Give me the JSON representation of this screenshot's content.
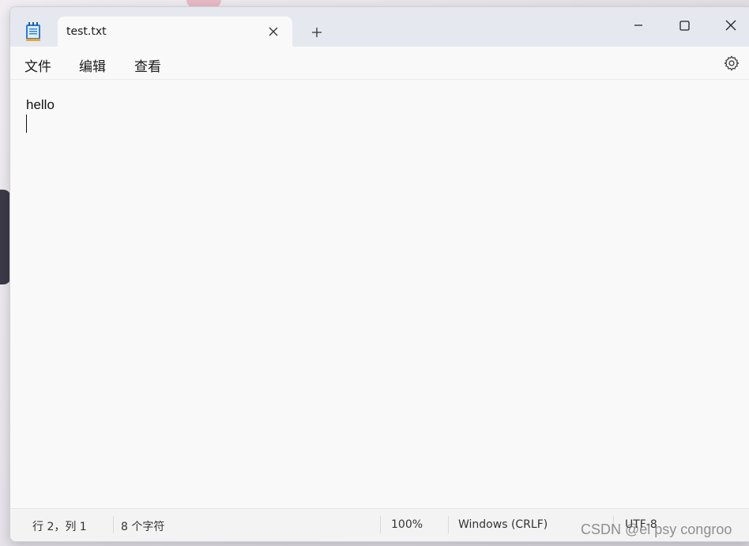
{
  "tab": {
    "title": "test.txt"
  },
  "menu": {
    "file": "文件",
    "edit": "编辑",
    "view": "查看"
  },
  "editor": {
    "lines": [
      "hello",
      ""
    ]
  },
  "status": {
    "position": "行 2，列 1",
    "chars": "8 个字符",
    "zoom": "100%",
    "line_ending": "Windows (CRLF)",
    "encoding": "UTF-8"
  },
  "watermark": "CSDN @el psy congroo",
  "colors": {
    "titlebar": "#e5e8ee",
    "editor_bg": "#f9f9f9",
    "statusbar": "#f3f3f3",
    "icon_blue": "#2a7fd6"
  }
}
